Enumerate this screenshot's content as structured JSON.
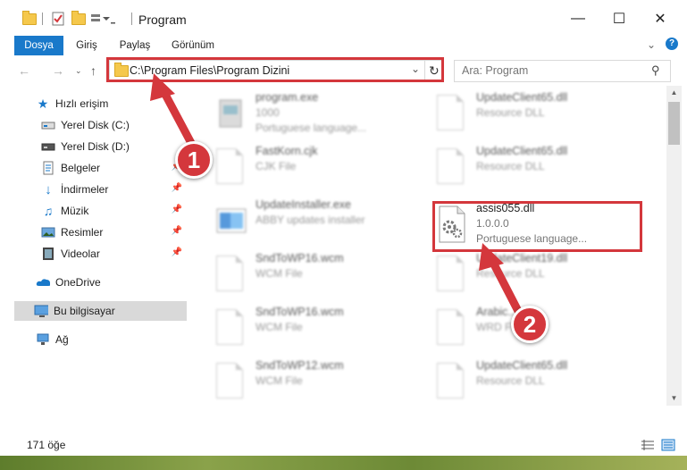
{
  "window": {
    "title": "Program"
  },
  "ribbon": {
    "tabs": [
      "Dosya",
      "Giriş",
      "Paylaş",
      "Görünüm"
    ]
  },
  "address_bar": {
    "path": "C:\\Program Files\\Program Dizini"
  },
  "search": {
    "placeholder": "Ara: Program"
  },
  "sidebar": {
    "quick_access": "Hızlı erişim",
    "items": [
      {
        "label": "Yerel Disk (C:)",
        "icon": "drive-icon"
      },
      {
        "label": "Yerel Disk (D:)",
        "icon": "drive-icon"
      },
      {
        "label": "Belgeler",
        "icon": "documents-icon"
      },
      {
        "label": "İndirmeler",
        "icon": "downloads-icon"
      },
      {
        "label": "Müzik",
        "icon": "music-icon"
      },
      {
        "label": "Resimler",
        "icon": "pictures-icon"
      },
      {
        "label": "Videolar",
        "icon": "videos-icon"
      }
    ],
    "onedrive": "OneDrive",
    "this_pc": "Bu bilgisayar",
    "network": "Ağ"
  },
  "files": {
    "left": [
      {
        "name": "program.exe",
        "sub1": "1000",
        "sub2": "Portuguese language..."
      },
      {
        "name": "FastKorn.cjk",
        "sub1": "CJK File",
        "sub2": ""
      },
      {
        "name": "UpdateInstaller.exe",
        "sub1": "ABBY updates installer",
        "sub2": ""
      },
      {
        "name": "SndToWP16.wcm",
        "sub1": "WCM File",
        "sub2": ""
      },
      {
        "name": "SndToWP16.wcm",
        "sub1": "WCM File",
        "sub2": ""
      },
      {
        "name": "SndToWP12.wcm",
        "sub1": "WCM File",
        "sub2": ""
      }
    ],
    "right": [
      {
        "name": "UpdateClient65.dll",
        "sub1": "Resource DLL",
        "sub2": ""
      },
      {
        "name": "UpdateClient65.dll",
        "sub1": "Resource DLL",
        "sub2": ""
      },
      {
        "name": "assis055.dll",
        "sub1": "1.0.0.0",
        "sub2": "Portuguese language..."
      },
      {
        "name": "UpdateClient19.dll",
        "sub1": "Resource DLL",
        "sub2": ""
      },
      {
        "name": "Arabic...",
        "sub1": "WRD File",
        "sub2": ""
      },
      {
        "name": "UpdateClient65.dll",
        "sub1": "Resource DLL",
        "sub2": ""
      }
    ]
  },
  "status": {
    "count": "171 öğe"
  },
  "annotations": {
    "step1": "1",
    "step2": "2",
    "color": "#d4373c"
  }
}
